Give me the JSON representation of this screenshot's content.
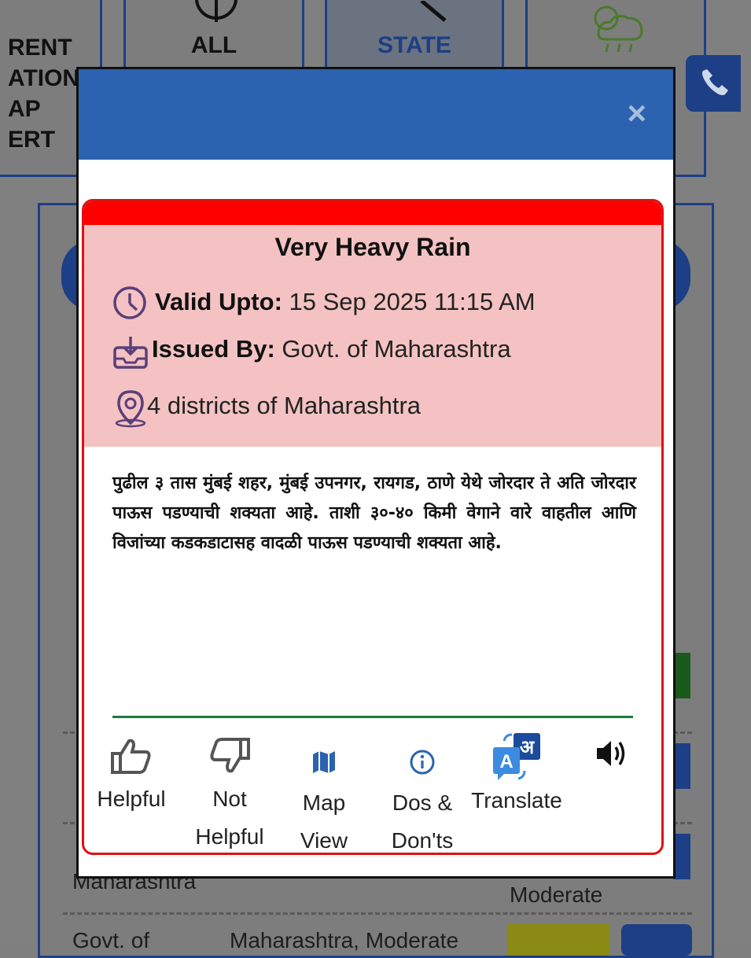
{
  "background": {
    "tiles": [
      {
        "lines": [
          "RENT",
          "ATION",
          "AP",
          "ERT"
        ]
      },
      {
        "label": "ALL"
      },
      {
        "label": "STATE"
      }
    ],
    "table_cells": {
      "row3_issuer": "Maharashtra",
      "row3_severity": "Moderate",
      "row4_issuer": "Govt. of",
      "row4_region": "Maharashtra, Moderate"
    }
  },
  "modal": {
    "close_label": "×",
    "alert": {
      "title": "Very Heavy Rain",
      "valid_label": "Valid Upto:",
      "valid_value": "15 Sep 2025 11:15 AM",
      "issued_label": "Issued By:",
      "issued_value": "Govt. of Maharashtra",
      "location": "4 districts of Maharashtra",
      "message": "पुढील ३ तास मुंबई शहर, मुंबई उपनगर, रायगड, ठाणे येथे जोरदार ते अति जोरदार पाऊस पडण्याची शक्यता आहे. ताशी ३०-४० किमी वेगाने वारे वाहतील आणि विजांच्या कडकडाटासह वादळी पाऊस पडण्याची शक्यता आहे."
    },
    "actions": {
      "helpful": "Helpful",
      "not_helpful_1": "Not",
      "not_helpful_2": "Helpful",
      "map_1": "Map",
      "map_2": "View",
      "dos_1": "Dos &",
      "dos_2": "Don'ts",
      "translate": "Translate"
    }
  },
  "colors": {
    "header_blue": "#2c63b0",
    "alert_red": "#ff0000",
    "alert_pink": "#f4c2c2",
    "divider_green": "#1a7a3c",
    "icon_purple": "#5b3f7a"
  }
}
